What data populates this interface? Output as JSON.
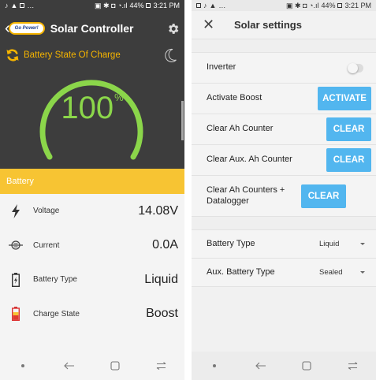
{
  "left": {
    "status": {
      "time": "3:21 PM",
      "battery": "44%"
    },
    "header": {
      "logo_text": "Go Power!",
      "title": "Solar Controller"
    },
    "gauge": {
      "title": "Battery State Of Charge",
      "value": "100",
      "unit": "%",
      "fill_fraction": 1.0,
      "ring_color": "#8bd64a"
    },
    "section_label": "Battery",
    "rows": [
      {
        "icon": "lightning-icon",
        "label": "Voltage",
        "value": "14.08V"
      },
      {
        "icon": "current-icon",
        "label": "Current",
        "value": "0.0A"
      },
      {
        "icon": "battery-type-icon",
        "label": "Battery Type",
        "value": "Liquid"
      },
      {
        "icon": "battery-charge-icon",
        "label": "Charge State",
        "value": "Boost"
      }
    ]
  },
  "right": {
    "status": {
      "time": "3:21 PM",
      "battery": "44%"
    },
    "header": {
      "title": "Solar settings"
    },
    "settings": {
      "inverter_label": "Inverter",
      "boost_label": "Activate Boost",
      "boost_button": "ACTIVATE",
      "clear_ah_label": "Clear Ah Counter",
      "clear_ah_button": "CLEAR",
      "clear_aux_label": "Clear Aux. Ah Counter",
      "clear_aux_button": "CLEAR",
      "clear_all_label": "Clear Ah Counters + Datalogger",
      "clear_all_button": "CLEAR"
    },
    "types": {
      "battery_type_label": "Battery Type",
      "battery_type_value": "Liquid",
      "aux_type_label": "Aux. Battery Type",
      "aux_type_value": "Sealed"
    }
  },
  "colors": {
    "accent_yellow": "#f7c433",
    "button_blue": "#52b6ef",
    "gauge_green": "#8bd64a",
    "header_dark": "#3d3d3d"
  }
}
